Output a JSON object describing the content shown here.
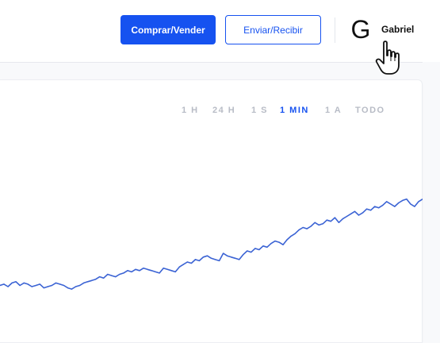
{
  "header": {
    "buy_sell_label": "Comprar/Vender",
    "send_receive_label": "Enviar/Recibir",
    "avatar_letter": "G",
    "username": "Gabriel"
  },
  "timeframes": [
    {
      "label": "1 H",
      "active": false
    },
    {
      "label": "24 H",
      "active": false
    },
    {
      "label": "1 S",
      "active": false
    },
    {
      "label": "1 MIN",
      "active": true
    },
    {
      "label": "1 A",
      "active": false
    },
    {
      "label": "TODO",
      "active": false
    }
  ],
  "colors": {
    "accent": "#1652f0",
    "line": "#3b63d4",
    "inactive_tab": "#b8bcc6"
  },
  "icons": {
    "cursor": "hand-pointer-icon"
  },
  "chart_data": {
    "type": "line",
    "title": "",
    "xlabel": "",
    "ylabel": "",
    "x": [
      0,
      1,
      2,
      3,
      4,
      5,
      6,
      7,
      8,
      9,
      10,
      11,
      12,
      13,
      14,
      15,
      16,
      17,
      18,
      19,
      20,
      21,
      22,
      23,
      24,
      25,
      26,
      27,
      28,
      29,
      30,
      31,
      32,
      33,
      34,
      35,
      36,
      37,
      38,
      39,
      40,
      41,
      42,
      43,
      44,
      45,
      46,
      47,
      48,
      49,
      50,
      51,
      52,
      53,
      54,
      55,
      56,
      57,
      58,
      59,
      60,
      61,
      62,
      63,
      64,
      65,
      66,
      67,
      68,
      69,
      70,
      71,
      72,
      73,
      74,
      75,
      76,
      77,
      78,
      79,
      80,
      81,
      82,
      83,
      84,
      85,
      86,
      87,
      88,
      89,
      90,
      91,
      92,
      93,
      94,
      95,
      96,
      97,
      98,
      99,
      100,
      101,
      102,
      103,
      104,
      105,
      106
    ],
    "series": [
      {
        "values": [
          10,
          11,
          9,
          12,
          13,
          10,
          12,
          11,
          9,
          10,
          11,
          8,
          9,
          10,
          12,
          11,
          10,
          8,
          7,
          9,
          10,
          12,
          13,
          14,
          15,
          17,
          16,
          19,
          18,
          17,
          19,
          20,
          22,
          21,
          23,
          22,
          24,
          23,
          22,
          21,
          20,
          24,
          23,
          22,
          21,
          25,
          27,
          29,
          28,
          31,
          30,
          33,
          34,
          32,
          31,
          30,
          36,
          34,
          33,
          32,
          31,
          35,
          38,
          37,
          40,
          39,
          42,
          41,
          44,
          46,
          45,
          43,
          47,
          50,
          52,
          55,
          57,
          56,
          58,
          61,
          59,
          60,
          63,
          62,
          65,
          61,
          64,
          66,
          68,
          70,
          67,
          69,
          72,
          71,
          74,
          73,
          75,
          78,
          76,
          74,
          77,
          79,
          80,
          76,
          74,
          78,
          80
        ]
      }
    ],
    "ylim": [
      0,
      100
    ]
  }
}
